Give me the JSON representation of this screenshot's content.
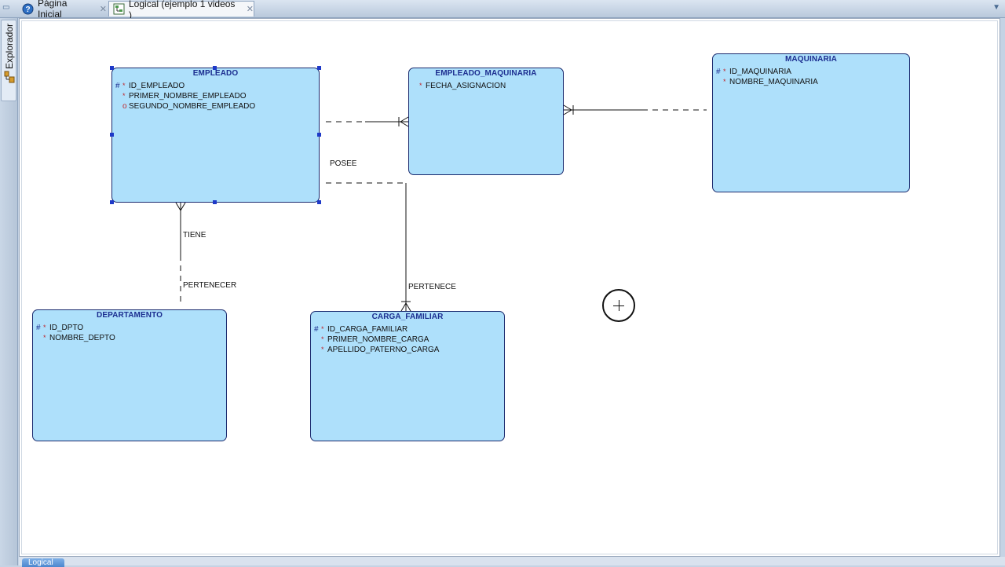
{
  "tabs": [
    {
      "label": "Página Inicial",
      "icon": "help-icon"
    },
    {
      "label": "Logical (ejemplo 1 videos )",
      "icon": "diagram-icon"
    }
  ],
  "sidebar": {
    "label": "Explorador"
  },
  "entities": {
    "empleado": {
      "title": "EMPLEADO",
      "attributes": [
        {
          "pk": "#",
          "mark": "*",
          "name": "ID_EMPLEADO"
        },
        {
          "pk": "",
          "mark": "*",
          "name": "PRIMER_NOMBRE_EMPLEADO"
        },
        {
          "pk": "",
          "mark": "o",
          "name": "SEGUNDO_NOMBRE_EMPLEADO"
        }
      ]
    },
    "empleado_maquinaria": {
      "title": "EMPLEADO_MAQUINARIA",
      "attributes": [
        {
          "pk": "",
          "mark": "*",
          "name": "FECHA_ASIGNACION"
        }
      ]
    },
    "maquinaria": {
      "title": "MAQUINARIA",
      "attributes": [
        {
          "pk": "#",
          "mark": "*",
          "name": "ID_MAQUINARIA"
        },
        {
          "pk": "",
          "mark": "*",
          "name": "NOMBRE_MAQUINARIA"
        }
      ]
    },
    "departamento": {
      "title": "DEPARTAMENTO",
      "attributes": [
        {
          "pk": "#",
          "mark": "*",
          "name": "ID_DPTO"
        },
        {
          "pk": "",
          "mark": "*",
          "name": "NOMBRE_DEPTO"
        }
      ]
    },
    "carga_familiar": {
      "title": "CARGA_FAMILIAR",
      "attributes": [
        {
          "pk": "#",
          "mark": "*",
          "name": "ID_CARGA_FAMILIAR"
        },
        {
          "pk": "",
          "mark": "*",
          "name": "PRIMER_NOMBRE_CARGA"
        },
        {
          "pk": "",
          "mark": "*",
          "name": "APELLIDO_PATERNO_CARGA"
        }
      ]
    }
  },
  "relationships": {
    "posee": "POSEE",
    "tiene": "TIENE",
    "pertenecer": "PERTENECER",
    "pertenece": "PERTENECE"
  },
  "bottom_tab": {
    "label": "Logical"
  }
}
